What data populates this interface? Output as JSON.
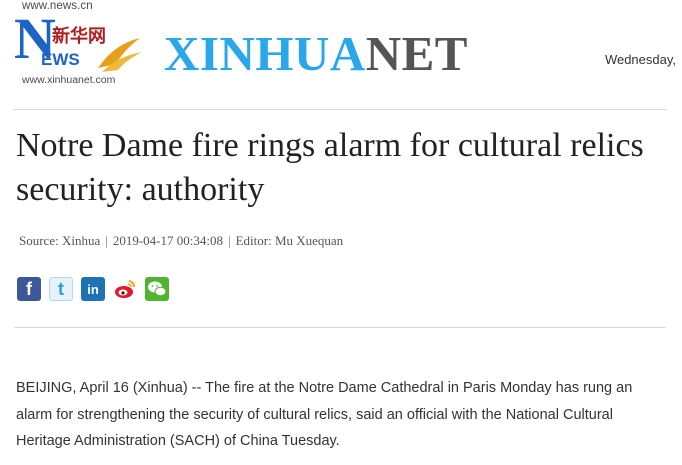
{
  "header": {
    "logo_url": "www.news.cn",
    "logo_n": "N",
    "logo_cn": "新华网",
    "logo_ews": "EWS",
    "logo_sub": "www.xinhuanet.com",
    "brand_xinhua": "XINHUA",
    "brand_net": "NET",
    "date": "Wednesday,"
  },
  "article": {
    "title": "Notre Dame fire rings alarm for cultural relics security: authority",
    "source": "Source: Xinhua",
    "timestamp": "2019-04-17 00:34:08",
    "editor": "Editor: Mu Xuequan",
    "separator": "|",
    "body": "BEIJING, April 16 (Xinhua) -- The fire at the Notre Dame Cathedral in Paris Monday has rung an alarm for strengthening the security of cultural relics, said an official with the National Cultural Heritage Administration (SACH) of China Tuesday."
  },
  "share": {
    "icons": [
      "facebook-icon",
      "twitter-icon",
      "linkedin-icon",
      "weibo-icon",
      "wechat-icon"
    ],
    "facebook_glyph": "f",
    "twitter_glyph": "t",
    "linkedin_glyph": "in"
  },
  "colors": {
    "brand_blue": "#2aa6ea",
    "brand_gray": "#555555",
    "logo_blue": "#1e63c6",
    "logo_red": "#b01f1f"
  }
}
